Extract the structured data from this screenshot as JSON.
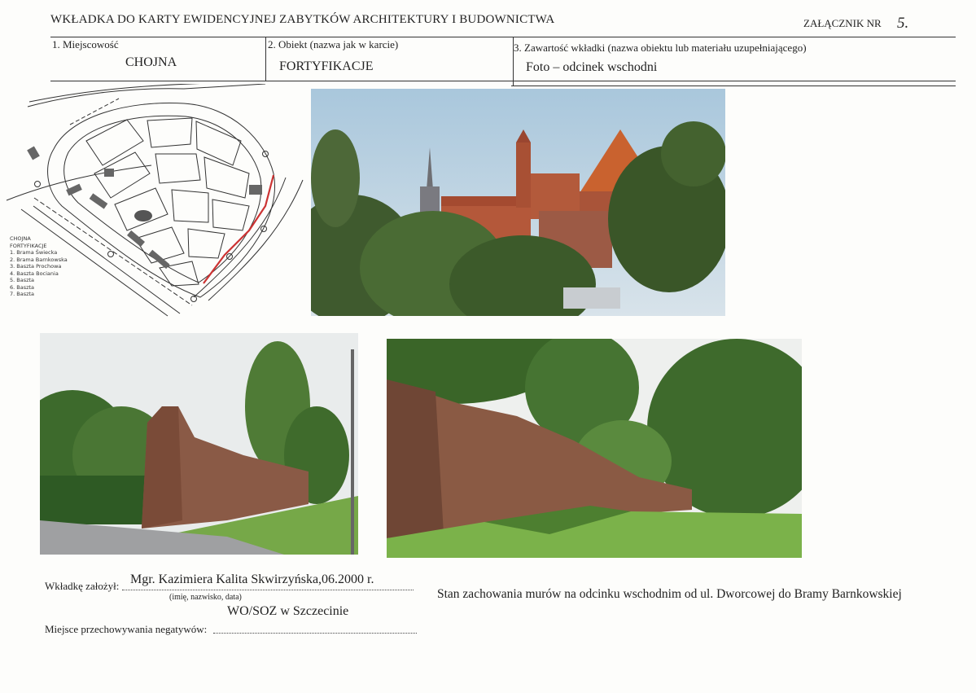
{
  "header": {
    "title": "WKŁADKA DO KARTY EWIDENCYJNEJ ZABYTKÓW ARCHITEKTURY I BUDOWNICTWA",
    "attachment_label": "ZAŁĄCZNIK NR",
    "attachment_number": "5."
  },
  "fields": {
    "locality_label": "1. Miejscowość",
    "locality_value": "CHOJNA",
    "object_label": "2. Obiekt (nazwa jak w karcie)",
    "object_value": "FORTYFIKACJE",
    "content_label": "3. Zawartość wkładki (nazwa obiektu lub materiału uzupełniającego)",
    "content_value": "Foto – odcinek wschodni"
  },
  "map": {
    "legend_title": "CHOJNA",
    "legend_subtitle": "FORTYFIKACJE",
    "legend_items": [
      "1. Brama Świecka",
      "2. Brama Barnkowska",
      "3. Baszta Prochowa",
      "4. Baszta Bociania",
      "5. Baszta",
      "6. Baszta",
      "7. Baszta"
    ]
  },
  "footer": {
    "founder_label": "Wkładkę założył:",
    "founder_value": "Mgr. Kazimiera Kalita Skwirzyńska,06.2000 r.",
    "founder_note": "(imię, nazwisko, data)",
    "institution": "WO/SOZ w Szczecinie",
    "negatives_label": "Miejsce przechowywania negatywów:",
    "caption": "Stan zachowania murów na odcinku wschodnim od ul. Dworcowej do Bramy Barnkowskiej"
  }
}
